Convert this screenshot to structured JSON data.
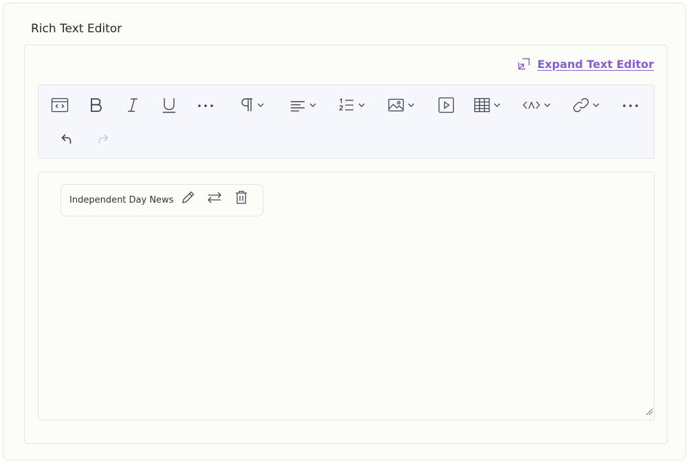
{
  "section": {
    "title": "Rich Text Editor"
  },
  "expand": {
    "label": "Expand Text Editor",
    "icon": "expand-icon",
    "color": "#8a5bd2"
  },
  "toolbar": {
    "buttons": [
      {
        "name": "source-code",
        "icon": "source-code-icon",
        "dropdown": false
      },
      {
        "name": "bold",
        "icon": "bold-icon",
        "dropdown": false
      },
      {
        "name": "italic",
        "icon": "italic-icon",
        "dropdown": false
      },
      {
        "name": "underline",
        "icon": "underline-icon",
        "dropdown": false
      },
      {
        "name": "more-formatting",
        "icon": "more-horizontal-icon",
        "dropdown": false
      },
      {
        "name": "paragraph",
        "icon": "paragraph-icon",
        "dropdown": true
      },
      {
        "name": "align",
        "icon": "align-left-icon",
        "dropdown": true
      },
      {
        "name": "numbered-list",
        "icon": "numbered-list-icon",
        "dropdown": true
      },
      {
        "name": "image",
        "icon": "image-icon",
        "dropdown": true
      },
      {
        "name": "video",
        "icon": "video-icon",
        "dropdown": false
      },
      {
        "name": "table",
        "icon": "table-icon",
        "dropdown": true
      },
      {
        "name": "code-view",
        "icon": "code-view-icon",
        "dropdown": true
      },
      {
        "name": "link",
        "icon": "link-icon",
        "dropdown": true
      },
      {
        "name": "more-options",
        "icon": "more-horizontal-icon",
        "dropdown": false
      },
      {
        "name": "undo",
        "icon": "undo-icon",
        "dropdown": false
      },
      {
        "name": "redo",
        "icon": "redo-icon",
        "dropdown": false,
        "disabled": true
      }
    ]
  },
  "editor": {
    "link_popover": {
      "text": "Independent Day News",
      "actions": [
        "edit-link-icon",
        "replace-link-icon",
        "delete-link-icon"
      ]
    }
  },
  "colors": {
    "accent": "#8a5bd2",
    "toolbar_bg": "#f5f7fb",
    "border": "#e0e3ea",
    "canvas": "#fdfdf8"
  }
}
